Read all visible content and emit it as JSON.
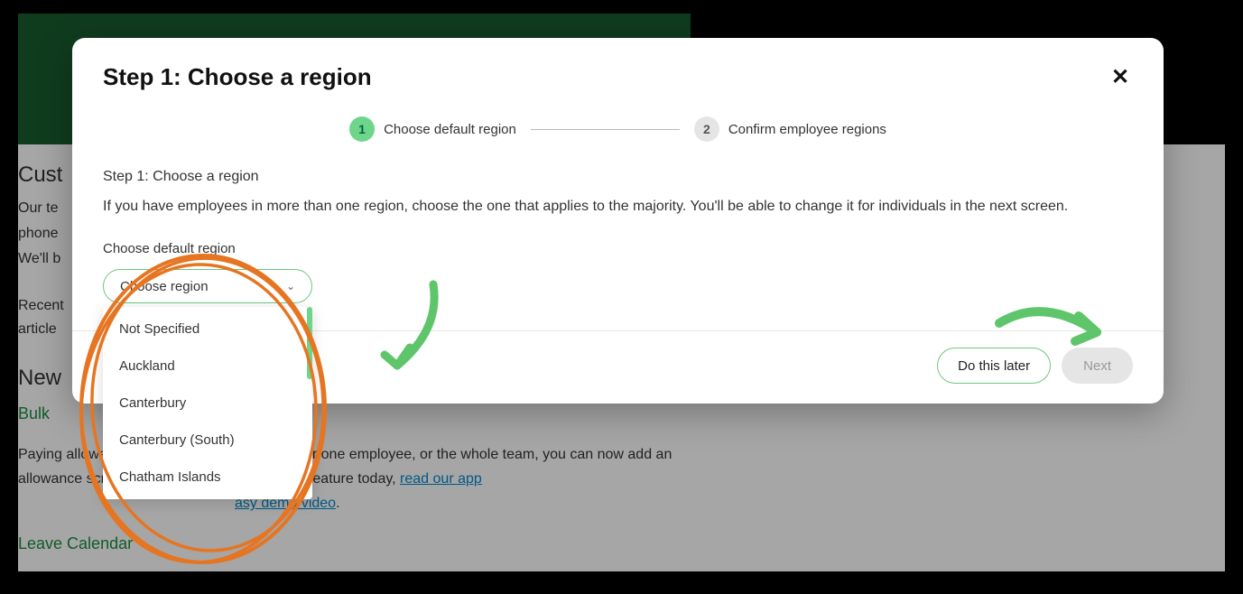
{
  "background": {
    "cust": "Cust",
    "ourt": "Our te",
    "phone": "phone",
    "wellb": "We'll b",
    "recent": "Recent",
    "article": "article",
    "new": "New",
    "bulk": "Bulk",
    "paying_text": "Paying allowances is coming or whether it's for one employee, or the whole team, you can now add an allowance screen! Get started using this new feature today, ",
    "paying_link": "read our app",
    "easy_link": "asy demo video",
    "leave": "Leave Calendar"
  },
  "modal": {
    "title": "Step 1: Choose a region",
    "close": "✕",
    "stepper": {
      "step1": {
        "num": "1",
        "label": "Choose default region"
      },
      "step2": {
        "num": "2",
        "label": "Confirm employee regions"
      }
    },
    "subheading": "Step 1: Choose a region",
    "description": "If you have employees in more than one region, choose the one that applies to the majority. You'll be able to change it for individuals in the next screen.",
    "field_label": "Choose default region",
    "select_placeholder": "Choose region",
    "options": [
      "Not Specified",
      "Auckland",
      "Canterbury",
      "Canterbury (South)",
      "Chatham Islands"
    ],
    "footer": {
      "later": "Do this later",
      "next": "Next"
    }
  }
}
